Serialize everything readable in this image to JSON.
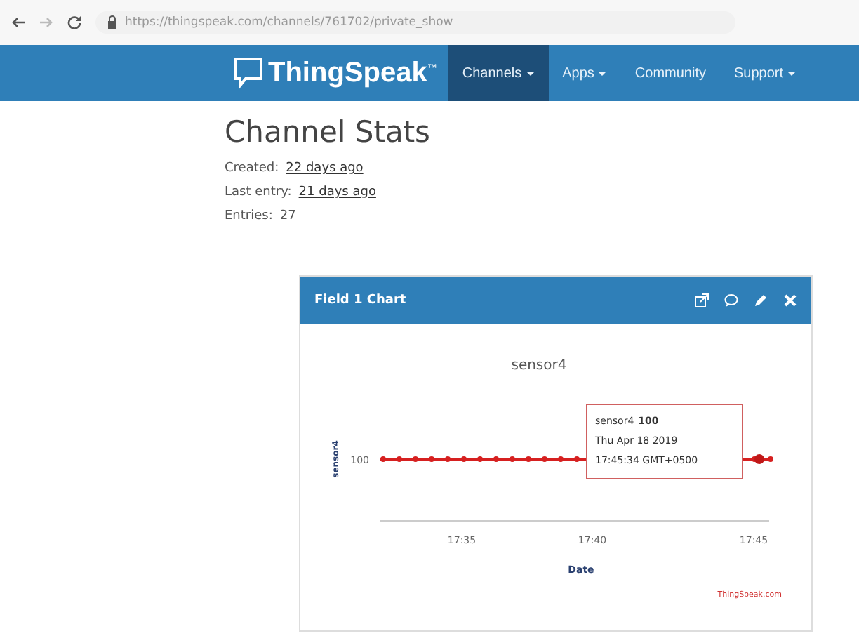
{
  "browser": {
    "url": "https://thingspeak.com/channels/761702/private_show"
  },
  "nav": {
    "logo": "ThingSpeak",
    "logo_mark": "™",
    "items": [
      {
        "label": "Channels",
        "dropdown": true,
        "selected": true
      },
      {
        "label": "Apps",
        "dropdown": true,
        "selected": false
      },
      {
        "label": "Community",
        "dropdown": false,
        "selected": false
      },
      {
        "label": "Support",
        "dropdown": true,
        "selected": false
      }
    ]
  },
  "stats": {
    "title": "Channel Stats",
    "rows": [
      {
        "label": "Created:",
        "value": "22 days ago",
        "kind": "link"
      },
      {
        "label": "Last entry:",
        "value": "21 days ago",
        "kind": "link"
      },
      {
        "label": "Entries:",
        "value": "27",
        "kind": "text"
      }
    ]
  },
  "panel": {
    "title": "Field 1 Chart",
    "chart": {
      "title": "sensor4",
      "ylabel": "sensor4",
      "ytick": "100",
      "xticks": [
        "17:35",
        "17:40",
        "17:45"
      ],
      "xlabel": "Date",
      "credit": "ThingSpeak.com",
      "tooltip": {
        "series": "sensor4",
        "value": "100",
        "date": "Thu Apr 18 2019",
        "time": "17:45:34 GMT+0500"
      }
    }
  }
}
